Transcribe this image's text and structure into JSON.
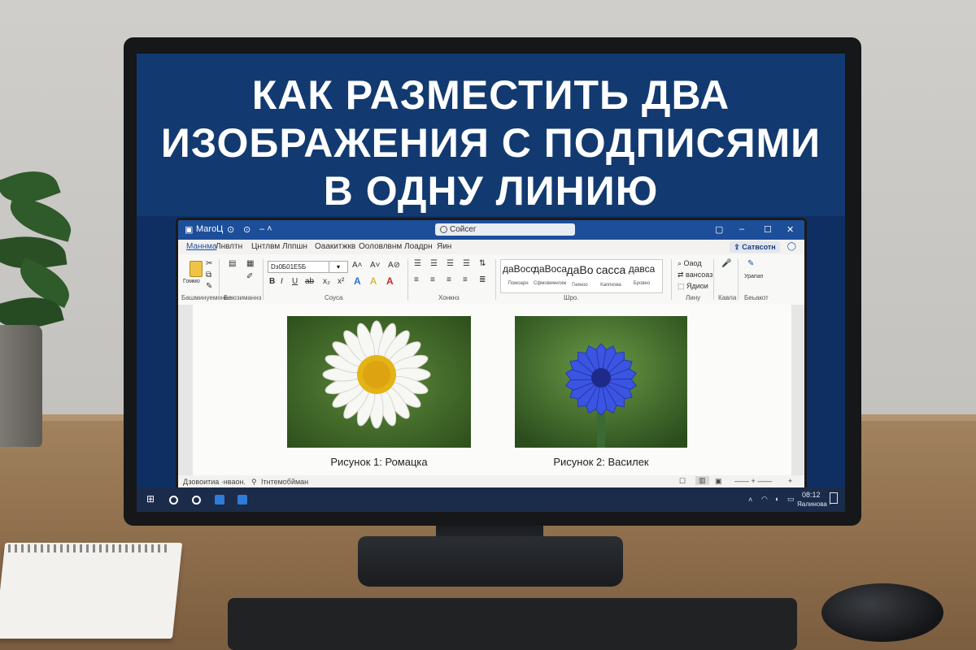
{
  "headline": [
    "КАК РАЗМЕСТИТЬ ДВА",
    "ИЗОБРАЖЕНИЯ С ПОДПИСЯМИ",
    "В ОДНУ ЛИНИЮ"
  ],
  "window": {
    "app_name": "МаrоЦ",
    "search": "Сойсег",
    "share_button": "Сатвсотн"
  },
  "menu": [
    "Маннма",
    "Лнвлтн",
    "Цнтлвм",
    "Лппшн",
    "Оаакитжкв",
    "Ооловлвнм",
    "Лоадрн",
    "Яин"
  ],
  "ribbon": {
    "font_name": "Dз0Б01Е5Б",
    "group_labels": [
      "Башминуемонее",
      "Блюзиманнз",
      "Соуса",
      "Хонкнз",
      "Шро.",
      "Лину",
      "Кавла",
      "Беьакот"
    ],
    "clipboard_label": "Гоммо",
    "styles": [
      {
        "sample": "даBoco",
        "name": "Помоарн"
      },
      {
        "sample": "даBoca",
        "name": "Сфмовемнгиж"
      },
      {
        "sample": "даВо",
        "name": "Гниноо"
      },
      {
        "sample": "сасса",
        "name": "Каппкова"
      },
      {
        "sample": "давса",
        "name": "Бровео"
      }
    ],
    "editing": [
      "Оаод",
      "вансоаз",
      "Ядиои"
    ],
    "extra": "Урапап"
  },
  "document": {
    "caption_left": "Рисунок 1: Ромацка",
    "caption_right": "Рисунок 2: Василек"
  },
  "status": {
    "left": "Дзовоитиа ·нваон.",
    "middle": "Ітнтемобйман"
  },
  "taskbar": {
    "time": "08:12",
    "date": "Яалинова ·"
  },
  "colors": {
    "title_bg": "#123a70",
    "word_blue": "#1d4e9a",
    "cornflower": "#3b55e0",
    "daisy_center": "#e4b315"
  }
}
